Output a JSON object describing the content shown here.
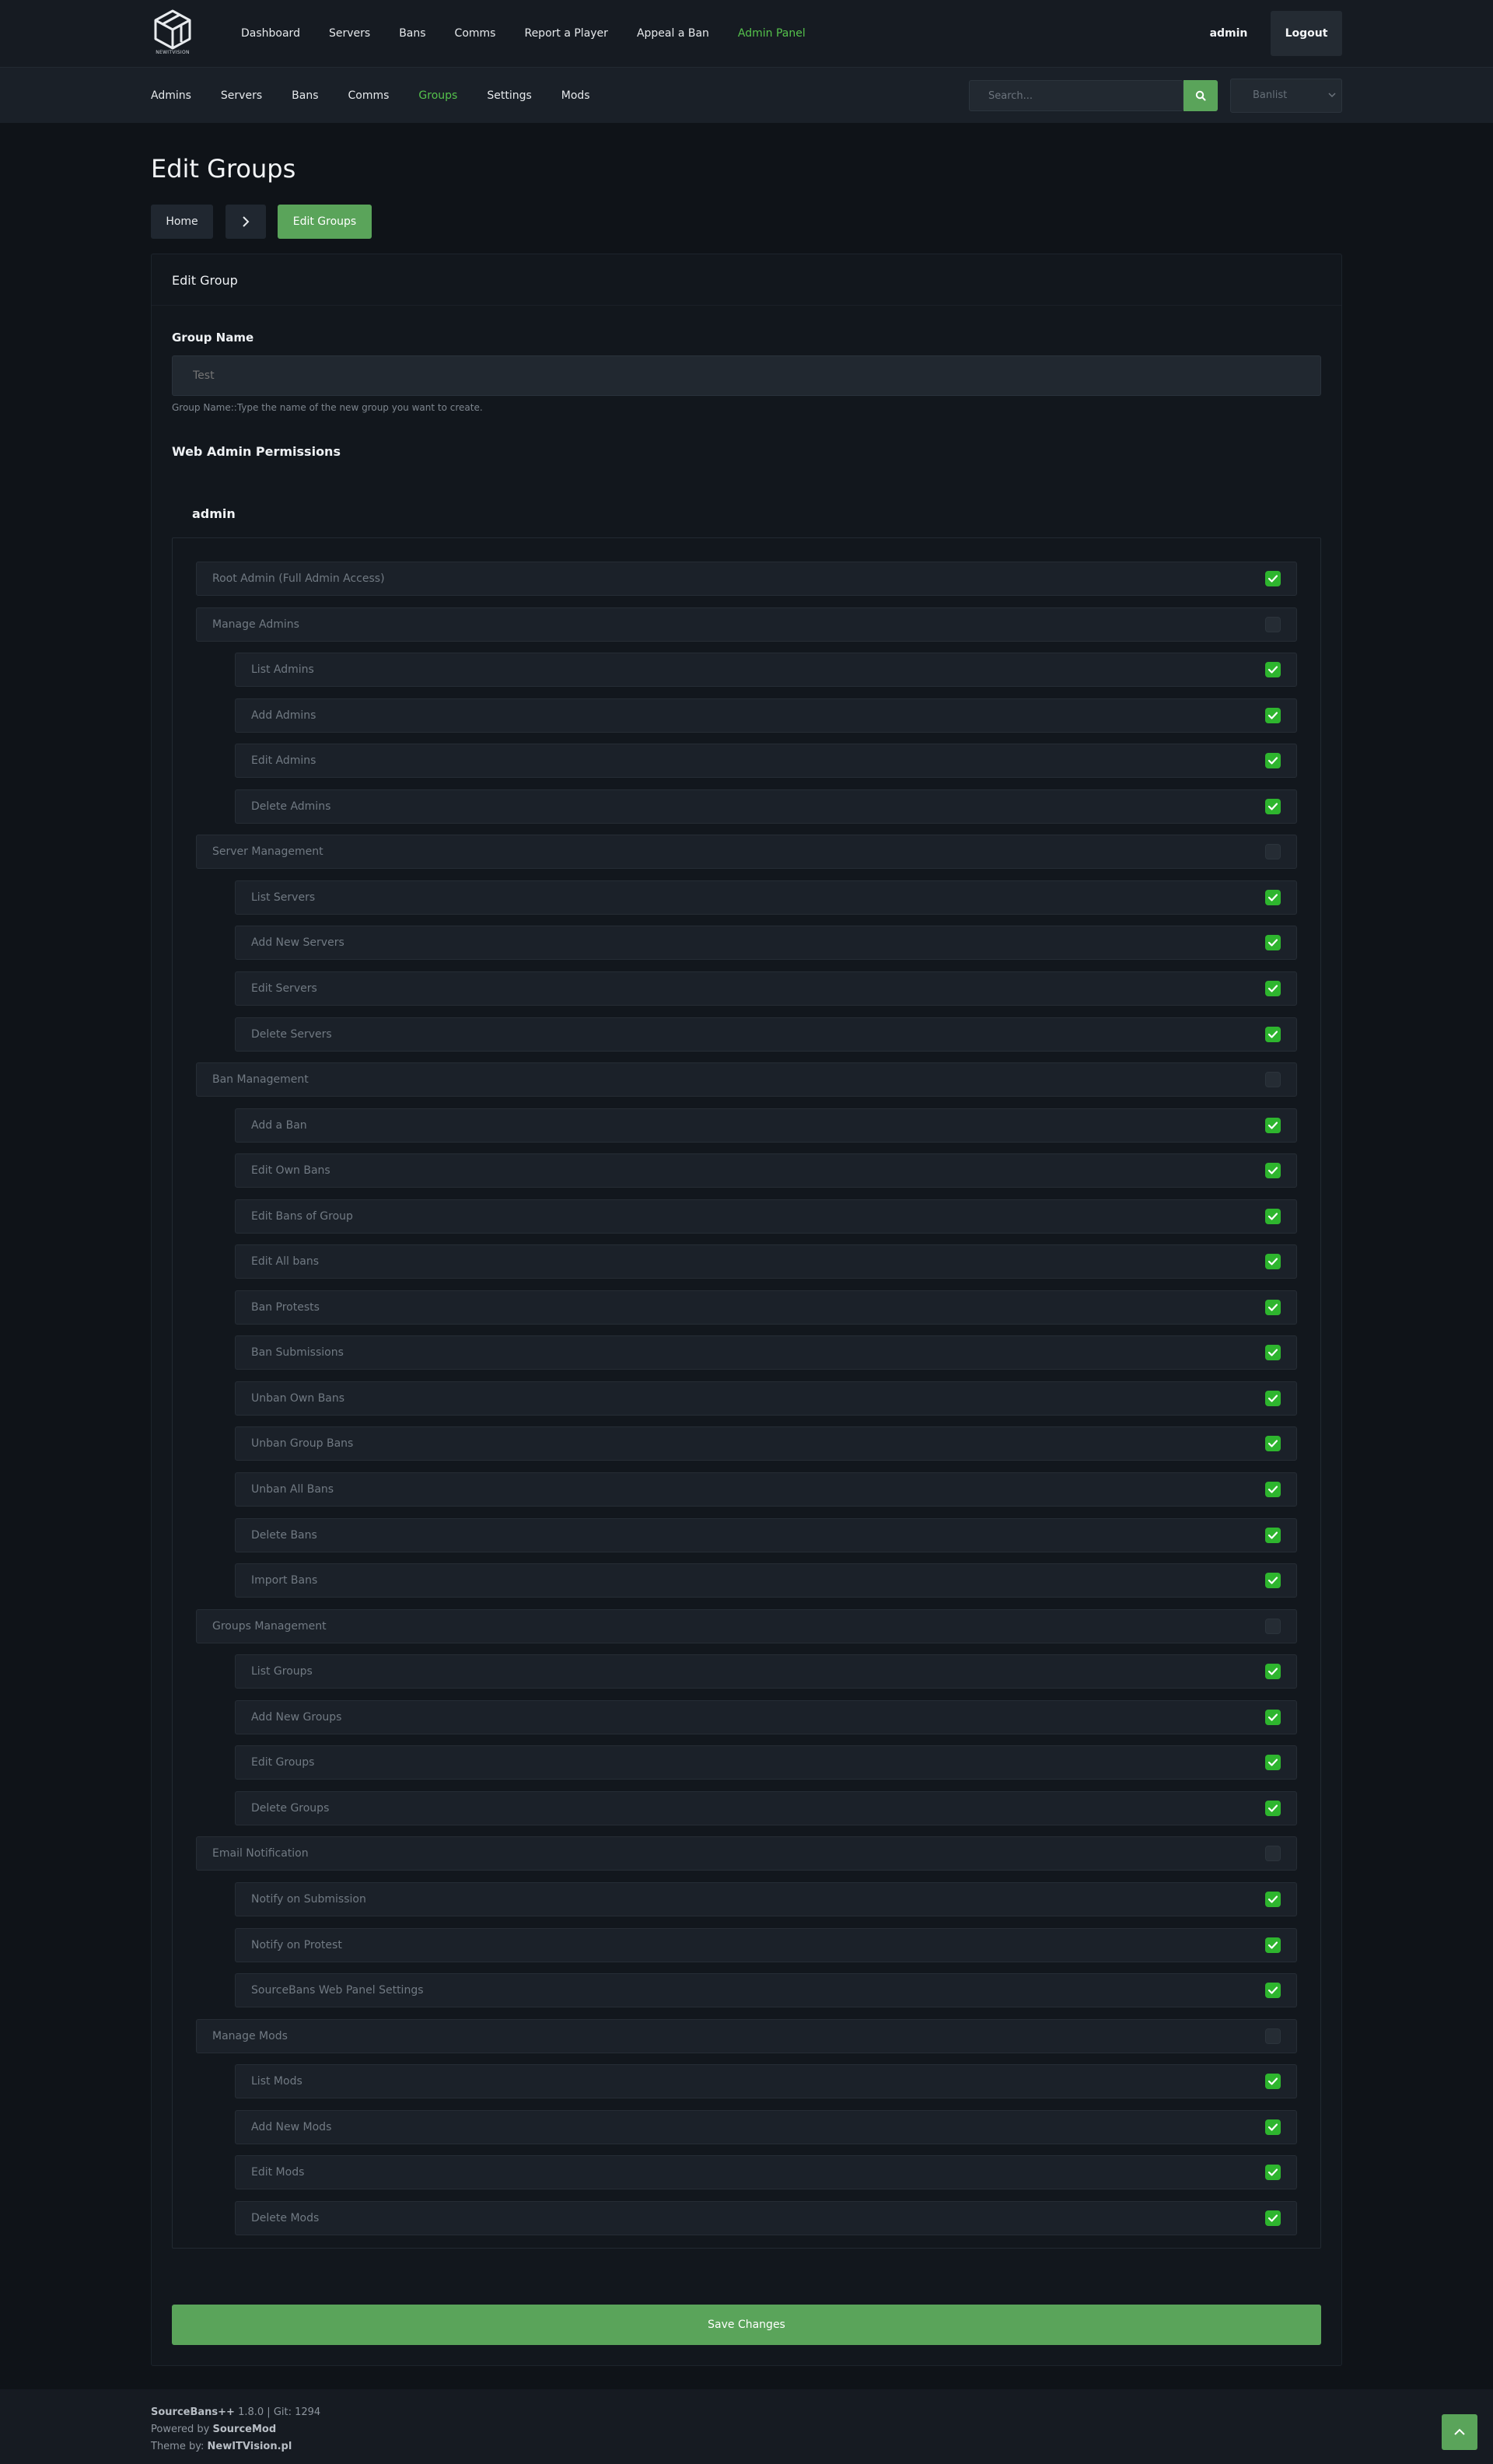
{
  "header": {
    "logo_text": "NEWITVISION",
    "nav": [
      "Dashboard",
      "Servers",
      "Bans",
      "Comms",
      "Report a Player",
      "Appeal a Ban",
      "Admin Panel"
    ],
    "active_nav": "Admin Panel",
    "user": "admin",
    "logout_label": "Logout"
  },
  "subnav": {
    "items": [
      "Admins",
      "Servers",
      "Bans",
      "Comms",
      "Groups",
      "Settings",
      "Mods"
    ],
    "active": "Groups",
    "search_placeholder": "Search...",
    "select_value": "Banlist"
  },
  "page": {
    "title": "Edit Groups",
    "breadcrumb": {
      "home": "Home",
      "current": "Edit Groups"
    }
  },
  "form": {
    "card_title": "Edit Group",
    "group_name_label": "Group Name",
    "group_name_value": "Test",
    "group_name_help": "Group Name::Type the name of the new group you want to create.",
    "permissions_title": "Web Admin Permissions",
    "admin_label": "admin",
    "save_label": "Save Changes"
  },
  "permissions": [
    {
      "label": "Root Admin (Full Admin Access)",
      "checked": true,
      "level": 0
    },
    {
      "label": "Manage Admins",
      "checked": false,
      "level": 0
    },
    {
      "label": "List Admins",
      "checked": true,
      "level": 1
    },
    {
      "label": "Add Admins",
      "checked": true,
      "level": 1
    },
    {
      "label": "Edit Admins",
      "checked": true,
      "level": 1
    },
    {
      "label": "Delete Admins",
      "checked": true,
      "level": 1
    },
    {
      "label": "Server Management",
      "checked": false,
      "level": 0
    },
    {
      "label": "List Servers",
      "checked": true,
      "level": 1
    },
    {
      "label": "Add New Servers",
      "checked": true,
      "level": 1
    },
    {
      "label": "Edit Servers",
      "checked": true,
      "level": 1
    },
    {
      "label": "Delete Servers",
      "checked": true,
      "level": 1
    },
    {
      "label": "Ban Management",
      "checked": false,
      "level": 0
    },
    {
      "label": "Add a Ban",
      "checked": true,
      "level": 1
    },
    {
      "label": "Edit Own Bans",
      "checked": true,
      "level": 1
    },
    {
      "label": "Edit Bans of Group",
      "checked": true,
      "level": 1
    },
    {
      "label": "Edit All bans",
      "checked": true,
      "level": 1
    },
    {
      "label": "Ban Protests",
      "checked": true,
      "level": 1
    },
    {
      "label": "Ban Submissions",
      "checked": true,
      "level": 1
    },
    {
      "label": "Unban Own Bans",
      "checked": true,
      "level": 1
    },
    {
      "label": "Unban Group Bans",
      "checked": true,
      "level": 1
    },
    {
      "label": "Unban All Bans",
      "checked": true,
      "level": 1
    },
    {
      "label": "Delete Bans",
      "checked": true,
      "level": 1
    },
    {
      "label": "Import Bans",
      "checked": true,
      "level": 1
    },
    {
      "label": "Groups Management",
      "checked": false,
      "level": 0
    },
    {
      "label": "List Groups",
      "checked": true,
      "level": 1
    },
    {
      "label": "Add New Groups",
      "checked": true,
      "level": 1
    },
    {
      "label": "Edit Groups",
      "checked": true,
      "level": 1
    },
    {
      "label": "Delete Groups",
      "checked": true,
      "level": 1
    },
    {
      "label": "Email Notification",
      "checked": false,
      "level": 0
    },
    {
      "label": "Notify on Submission",
      "checked": true,
      "level": 1
    },
    {
      "label": "Notify on Protest",
      "checked": true,
      "level": 1
    },
    {
      "label": "SourceBans Web Panel Settings",
      "checked": true,
      "level": 1
    },
    {
      "label": "Manage Mods",
      "checked": false,
      "level": 0
    },
    {
      "label": "List Mods",
      "checked": true,
      "level": 1
    },
    {
      "label": "Add New Mods",
      "checked": true,
      "level": 1
    },
    {
      "label": "Edit Mods",
      "checked": true,
      "level": 1
    },
    {
      "label": "Delete Mods",
      "checked": true,
      "level": 1
    }
  ],
  "footer": {
    "product": "SourceBans++",
    "version": "1.8.0 | Git: 1294",
    "powered_prefix": "Powered by",
    "powered_by": "SourceMod",
    "theme_prefix": "Theme by:",
    "theme_by": "NewITVision.pl"
  },
  "colors": {
    "accent": "#5aa45a",
    "active_link": "#55c24c",
    "checkbox": "#2eb52e"
  }
}
